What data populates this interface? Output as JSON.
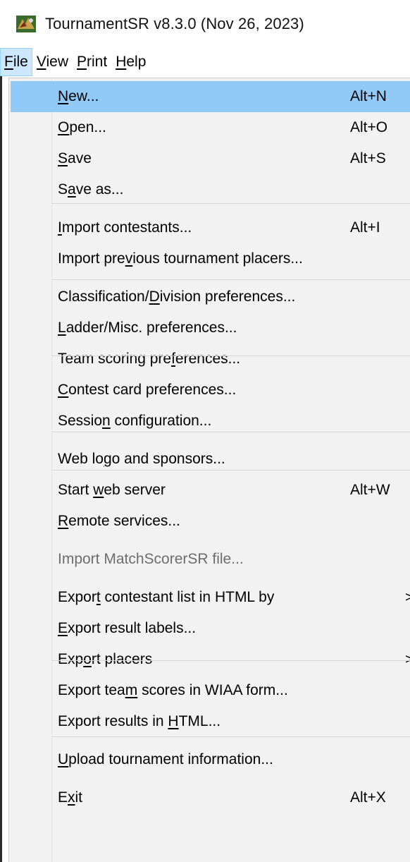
{
  "window": {
    "title": "TournamentSR v8.3.0 (Nov 26, 2023)",
    "icon": "app-logo-icon"
  },
  "menubar": {
    "items": [
      {
        "pre": "",
        "u": "F",
        "post": "ile"
      },
      {
        "pre": "",
        "u": "V",
        "post": "iew"
      },
      {
        "pre": "",
        "u": "P",
        "post": "rint"
      },
      {
        "pre": "",
        "u": "H",
        "post": "elp"
      }
    ]
  },
  "file_menu": {
    "items": [
      {
        "pre": "",
        "u": "N",
        "post": "ew...",
        "shortcut": "Alt+N",
        "highlight": true
      },
      {
        "pre": "",
        "u": "O",
        "post": "pen...",
        "shortcut": "Alt+O"
      },
      {
        "pre": "",
        "u": "S",
        "post": "ave",
        "shortcut": "Alt+S"
      },
      {
        "pre": "S",
        "u": "a",
        "post": "ve as...",
        "shortcut": ""
      },
      {
        "pre": "",
        "u": "I",
        "post": "mport contestants...",
        "shortcut": "Alt+I"
      },
      {
        "pre": "Import pre",
        "u": "v",
        "post": "ious tournament placers...",
        "shortcut": ""
      },
      {
        "pre": "Classification/",
        "u": "D",
        "post": "ivision preferences...",
        "shortcut": ""
      },
      {
        "pre": "",
        "u": "L",
        "post": "adder/Misc. preferences...",
        "shortcut": ""
      },
      {
        "pre": "Team scoring pre",
        "u": "f",
        "post": "erences...",
        "shortcut": ""
      },
      {
        "pre": "",
        "u": "C",
        "post": "ontest card preferences...",
        "shortcut": ""
      },
      {
        "pre": "Sessio",
        "u": "n",
        "post": " configuration...",
        "shortcut": ""
      },
      {
        "pre": "Web lo",
        "u": "g",
        "post": "o and sponsors...",
        "shortcut": ""
      },
      {
        "pre": "Start ",
        "u": "w",
        "post": "eb server",
        "shortcut": "Alt+W"
      },
      {
        "pre": "",
        "u": "R",
        "post": "emote services...",
        "shortcut": ""
      },
      {
        "pre": "Import MatchScorerSR file...",
        "u": "",
        "post": "",
        "shortcut": "",
        "disabled": true
      },
      {
        "pre": "Expor",
        "u": "t",
        "post": " contestant list in HTML by",
        "shortcut": "",
        "submenu": true
      },
      {
        "pre": "",
        "u": "E",
        "post": "xport result labels...",
        "shortcut": ""
      },
      {
        "pre": "Exp",
        "u": "o",
        "post": "rt placers",
        "shortcut": "",
        "submenu": true
      },
      {
        "pre": "Export tea",
        "u": "m",
        "post": " scores in WIAA form...",
        "shortcut": ""
      },
      {
        "pre": "Export results in ",
        "u": "H",
        "post": "TML...",
        "shortcut": ""
      },
      {
        "pre": "",
        "u": "U",
        "post": "pload tournament information...",
        "shortcut": ""
      },
      {
        "pre": "E",
        "u": "x",
        "post": "it",
        "shortcut": "Alt+X"
      }
    ],
    "submenu_glyph": ">"
  }
}
